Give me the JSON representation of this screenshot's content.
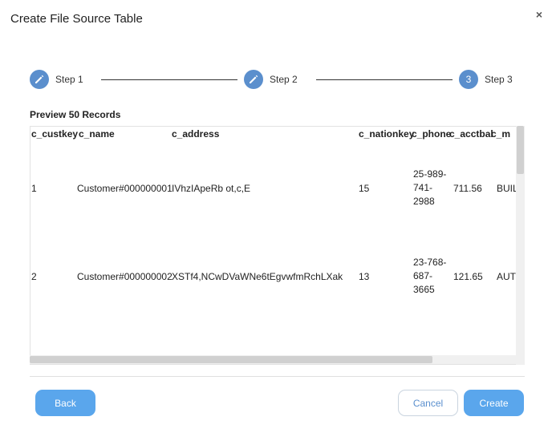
{
  "dialog": {
    "title": "Create File Source Table",
    "close_glyph": "×"
  },
  "steps": [
    {
      "label": "Step 1",
      "icon": "pencil-icon",
      "number": ""
    },
    {
      "label": "Step 2",
      "icon": "pencil-icon",
      "number": ""
    },
    {
      "label": "Step 3",
      "icon": "",
      "number": "3"
    }
  ],
  "preview": {
    "title": "Preview 50 Records",
    "columns": [
      "c_custkey",
      "c_name",
      "c_address",
      "c_nationkey",
      "c_phone",
      "c_acctbal",
      "c_m"
    ],
    "rows": [
      {
        "c_custkey": "1",
        "c_name": "Customer#000000001",
        "c_address": "IVhzIApeRb ot,c,E",
        "c_nationkey": "15",
        "c_phone_lines": [
          "25-989-",
          "741-",
          "2988"
        ],
        "c_acctbal": "711.56",
        "c_m": "BUIL"
      },
      {
        "c_custkey": "2",
        "c_name": "Customer#000000002",
        "c_address": "XSTf4,NCwDVaWNe6tEgvwfmRchLXak",
        "c_nationkey": "13",
        "c_phone_lines": [
          "23-768-",
          "687-",
          "3665"
        ],
        "c_acctbal": "121.65",
        "c_m": "AUT"
      }
    ]
  },
  "buttons": {
    "back": "Back",
    "cancel": "Cancel",
    "create": "Create"
  },
  "colors": {
    "step_circle": "#5b8fcd",
    "primary_button": "#5aa6ec",
    "secondary_text": "#5a8fce"
  }
}
